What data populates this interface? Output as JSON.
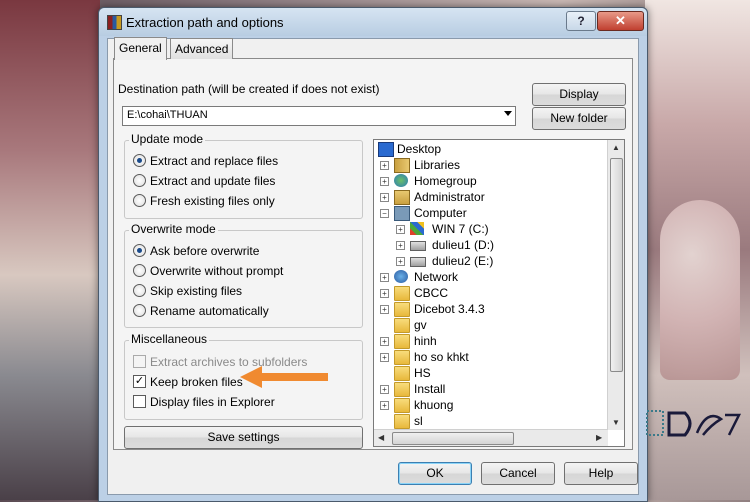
{
  "window": {
    "title": "Extraction path and options",
    "help_symbol": "?",
    "close_symbol": "✕"
  },
  "tabs": [
    {
      "label": "General",
      "selected": true
    },
    {
      "label": "Advanced",
      "selected": false
    }
  ],
  "destination": {
    "label": "Destination path (will be created if does not exist)",
    "value": "E:\\cohai\\THUAN"
  },
  "buttons": {
    "display": "Display",
    "new_folder": "New folder",
    "save_settings": "Save settings",
    "ok": "OK",
    "cancel": "Cancel",
    "help": "Help"
  },
  "update_mode": {
    "title": "Update mode",
    "options": [
      {
        "label": "Extract and replace files",
        "selected": true
      },
      {
        "label": "Extract and update files",
        "selected": false
      },
      {
        "label": "Fresh existing files only",
        "selected": false
      }
    ]
  },
  "overwrite_mode": {
    "title": "Overwrite mode",
    "options": [
      {
        "label": "Ask before overwrite",
        "selected": true
      },
      {
        "label": "Overwrite without prompt",
        "selected": false
      },
      {
        "label": "Skip existing files",
        "selected": false
      },
      {
        "label": "Rename automatically",
        "selected": false
      }
    ]
  },
  "miscellaneous": {
    "title": "Miscellaneous",
    "options": [
      {
        "label": "Extract archives to subfolders",
        "checked": false,
        "disabled": true
      },
      {
        "label": "Keep broken files",
        "checked": true,
        "disabled": false
      },
      {
        "label": "Display files in Explorer",
        "checked": false,
        "disabled": false
      }
    ]
  },
  "tree": {
    "items": [
      {
        "label": "Desktop",
        "icon": "desktop-icon"
      },
      {
        "label": "Libraries",
        "icon": "libraries-icon"
      },
      {
        "label": "Homegroup",
        "icon": "homegroup-icon"
      },
      {
        "label": "Administrator",
        "icon": "user-folder-icon"
      },
      {
        "label": "Computer",
        "icon": "computer-icon"
      },
      {
        "label": "WIN 7 (C:)",
        "icon": "windows-drive-icon"
      },
      {
        "label": "dulieu1 (D:)",
        "icon": "drive-icon"
      },
      {
        "label": "dulieu2 (E:)",
        "icon": "drive-icon"
      },
      {
        "label": "Network",
        "icon": "network-icon"
      },
      {
        "label": "CBCC",
        "icon": "folder-icon"
      },
      {
        "label": "Dicebot 3.4.3",
        "icon": "folder-icon"
      },
      {
        "label": "gv",
        "icon": "folder-icon"
      },
      {
        "label": "hinh",
        "icon": "folder-icon"
      },
      {
        "label": "ho so khkt",
        "icon": "folder-icon"
      },
      {
        "label": "HS",
        "icon": "folder-icon"
      },
      {
        "label": "Install",
        "icon": "folder-icon"
      },
      {
        "label": "khuong",
        "icon": "folder-icon"
      },
      {
        "label": "sl",
        "icon": "folder-icon"
      }
    ]
  },
  "annotation": {
    "color": "#f08a30",
    "icon": "orange-arrow-icon"
  }
}
